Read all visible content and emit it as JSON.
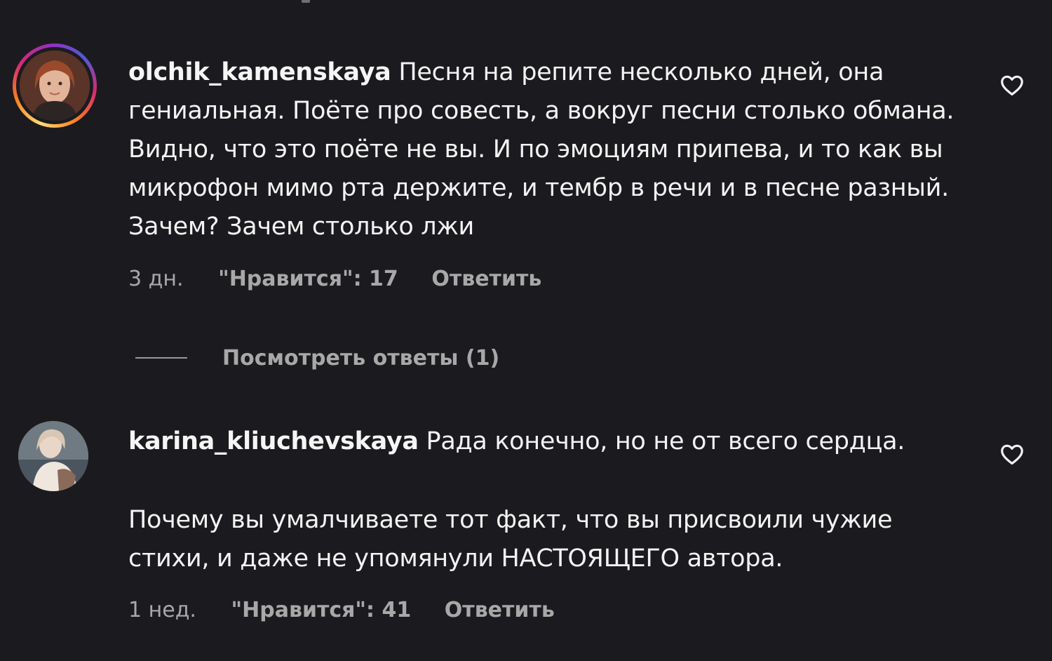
{
  "comments": [
    {
      "username": "olchik_kamenskaya",
      "text": "Песня на репите несколько дней, она гениальная. Поёте про совесть, а вокруг песни столько обмана. Видно, что это поёте не вы. И по эмоциям припева, и то как вы микрофон мимо рта держите, и тембр в речи и в песне разный. Зачем? Зачем столько лжи",
      "text2": "",
      "time": "3 дн.",
      "likes": "\"Нравится\": 17",
      "reply": "Ответить",
      "has_story_ring": true
    },
    {
      "username": "karina_kliuchevskaya",
      "text": "Рада конечно, но не от всего сердца.",
      "text2": "Почему вы умалчиваете тот факт, что вы присвоили чужие стихи, и даже не упомянули НАСТОЯЩЕГО автора.",
      "time": "1 нед.",
      "likes": "\"Нравится\": 41",
      "reply": "Ответить",
      "has_story_ring": false
    }
  ],
  "view_replies": "Посмотреть ответы (1)",
  "colors": {
    "background": "#1b1b1f",
    "text": "#f3f3f3",
    "meta": "#a8a8a8"
  },
  "icons": {
    "like": "heart-outline-icon"
  }
}
